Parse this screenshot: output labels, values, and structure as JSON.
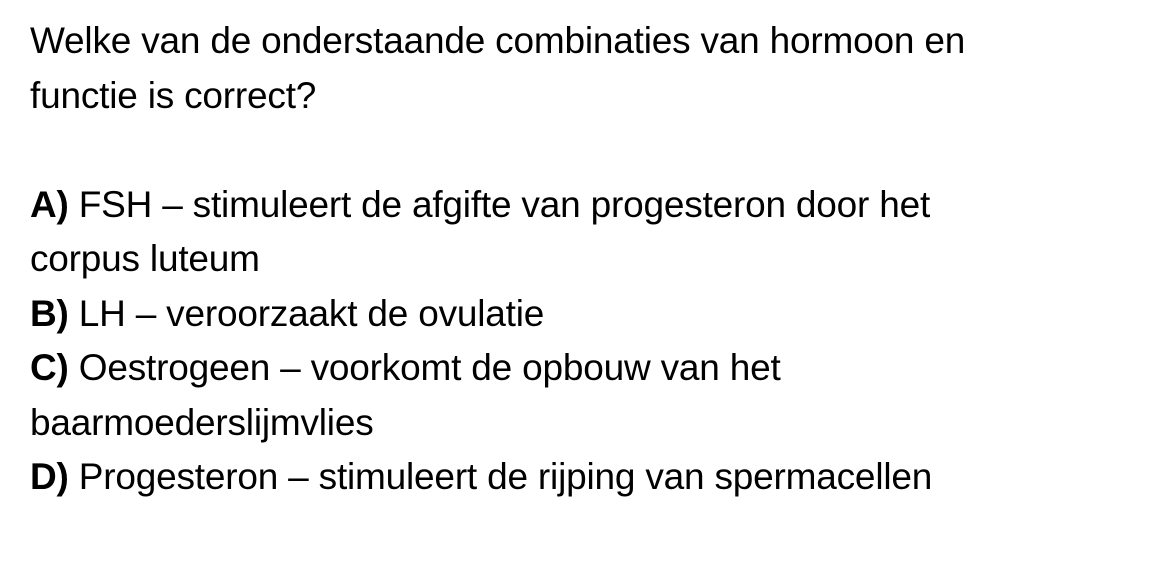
{
  "question": {
    "line1": "Welke van de onderstaande combinaties van hormoon en",
    "line2": "functie is correct?"
  },
  "options": [
    {
      "letter": "A)",
      "text_line1": " FSH – stimuleert de afgifte van progesteron door het",
      "text_line2": "corpus luteum"
    },
    {
      "letter": "B)",
      "text_line1": " LH – veroorzaakt de ovulatie"
    },
    {
      "letter": "C)",
      "text_line1": " Oestrogeen – voorkomt de opbouw van het",
      "text_line2": "baarmoederslijmvlies"
    },
    {
      "letter": "D)",
      "text_line1": " Progesteron – stimuleert de rijping van spermacellen"
    }
  ]
}
